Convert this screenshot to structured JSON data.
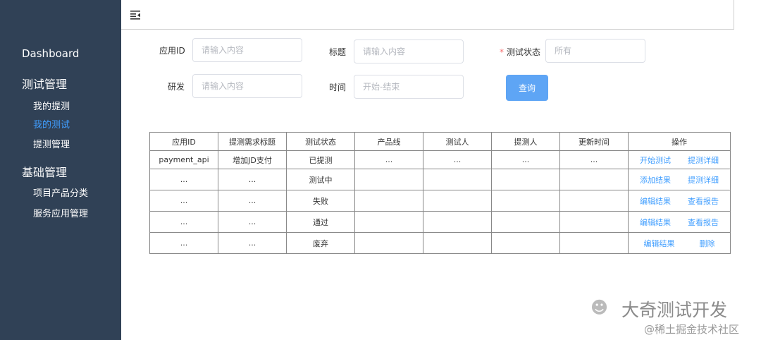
{
  "sidebar": {
    "dashboard": "Dashboard",
    "test_mgmt": "测试管理",
    "my_submissions": "我的提测",
    "my_tests": "我的测试",
    "submission_mgmt": "提测管理",
    "base_mgmt": "基础管理",
    "product_category": "项目产品分类",
    "service_app_mgmt": "服务应用管理"
  },
  "topbar": {
    "menu_icon": "hamburger-icon"
  },
  "filters": {
    "app_id": {
      "label": "应用ID",
      "placeholder": "请输入内容"
    },
    "title": {
      "label": "标题",
      "placeholder": "请输入内容"
    },
    "status": {
      "required_mark": "*",
      "label": "测试状态",
      "placeholder": "所有"
    },
    "developer": {
      "label": "研发",
      "placeholder": "请输入内容"
    },
    "time": {
      "label": "时间",
      "placeholder": "开始-结束"
    },
    "query_button": "查询"
  },
  "table": {
    "headers": [
      "应用ID",
      "提测需求标题",
      "测试状态",
      "产品线",
      "测试人",
      "提测人",
      "更新时间",
      "操作"
    ],
    "rows": [
      {
        "cells": [
          "payment_api",
          "增加JD支付",
          "已提测",
          "...",
          "...",
          "...",
          "..."
        ],
        "ops": [
          "开始测试",
          "提测详细"
        ]
      },
      {
        "cells": [
          "...",
          "...",
          "测试中",
          "",
          "",
          "",
          ""
        ],
        "ops": [
          "添加结果",
          "提测详细"
        ]
      },
      {
        "cells": [
          "...",
          "...",
          "失败",
          "",
          "",
          "",
          ""
        ],
        "ops": [
          "编辑结果",
          "查看报告"
        ]
      },
      {
        "cells": [
          "...",
          "...",
          "通过",
          "",
          "",
          "",
          ""
        ],
        "ops": [
          "编辑结果",
          "查看报告"
        ]
      },
      {
        "cells": [
          "...",
          "...",
          "废弃",
          "",
          "",
          "",
          ""
        ],
        "ops": [
          "编辑结果",
          "删除"
        ]
      }
    ]
  },
  "watermark": {
    "main": "大奇测试开发",
    "sub": "@稀土掘金技术社区"
  },
  "colors": {
    "sidebar_bg": "#304156",
    "accent": "#409eff",
    "button": "#5ea5f5",
    "required": "#f56c6c"
  }
}
